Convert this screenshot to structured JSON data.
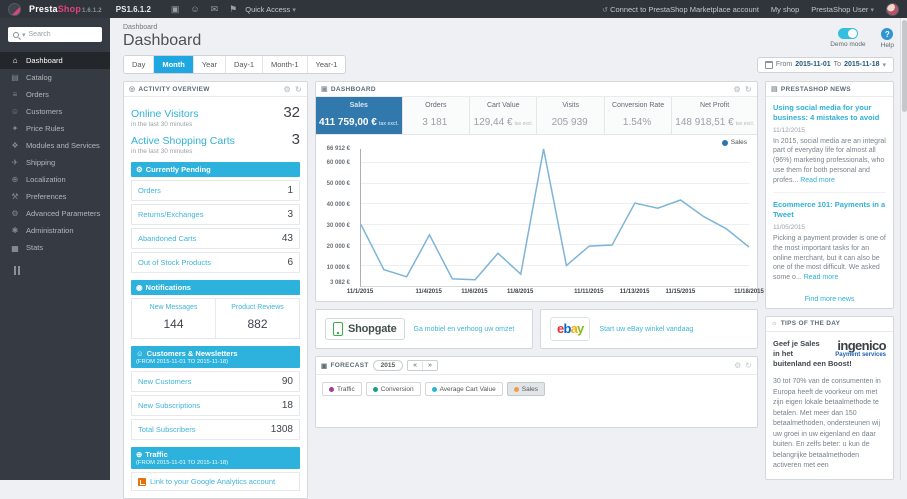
{
  "glyphs": {
    "caret_down": "▾",
    "cart": "▣",
    "person": "☺",
    "envelope": "✉",
    "pin": "⚑",
    "connect": "↺",
    "gear": "⚙",
    "refresh": "↻",
    "target": "◎",
    "bell": "◉",
    "globe": "⊕",
    "news": "▤",
    "bulb": "☼",
    "back": "«",
    "forward": "»",
    "help": "?"
  },
  "topbar": {
    "brand_presta": "Presta",
    "brand_shop": "Shop",
    "brand_version": "1.6.1.2",
    "ps_version": "PS1.6.1.2",
    "quick_access": "Quick Access",
    "connect": "Connect to PrestaShop Marketplace account",
    "my_shop": "My shop",
    "user": "PrestaShop User"
  },
  "sidebar": {
    "search_placeholder": "Search",
    "items": [
      {
        "label": "Dashboard",
        "icon": "⌂",
        "icon_name": "home-icon",
        "active": true
      },
      {
        "label": "Catalog",
        "icon": "▤",
        "icon_name": "catalog-icon"
      },
      {
        "label": "Orders",
        "icon": "≡",
        "icon_name": "orders-icon"
      },
      {
        "label": "Customers",
        "icon": "☺",
        "icon_name": "customers-icon"
      },
      {
        "label": "Price Rules",
        "icon": "✦",
        "icon_name": "price-rules-icon"
      },
      {
        "label": "Modules and Services",
        "icon": "❖",
        "icon_name": "modules-icon"
      },
      {
        "label": "Shipping",
        "icon": "✈",
        "icon_name": "shipping-icon"
      },
      {
        "label": "Localization",
        "icon": "⊕",
        "icon_name": "localization-icon"
      },
      {
        "label": "Preferences",
        "icon": "⚒",
        "icon_name": "preferences-icon"
      },
      {
        "label": "Advanced Parameters",
        "icon": "⚙",
        "icon_name": "advanced-parameters-icon"
      },
      {
        "label": "Administration",
        "icon": "✱",
        "icon_name": "administration-icon"
      },
      {
        "label": "Stats",
        "icon": "▅",
        "icon_name": "stats-icon"
      }
    ]
  },
  "header": {
    "breadcrumb": "Dashboard",
    "title": "Dashboard",
    "demo_mode_label": "Demo mode",
    "help_label": "Help"
  },
  "toolbar": {
    "tabs": [
      {
        "label": "Day"
      },
      {
        "label": "Month",
        "active": true
      },
      {
        "label": "Year"
      },
      {
        "label": "Day-1"
      },
      {
        "label": "Month-1"
      },
      {
        "label": "Year-1"
      }
    ],
    "date": {
      "from_label": "From",
      "from": "2015-11-01",
      "to_label": "To",
      "to": "2015-11-18"
    }
  },
  "activity": {
    "title": "ACTIVITY OVERVIEW",
    "stats": [
      {
        "label": "Online Visitors",
        "value": "32",
        "sub": "in the last 30 minutes"
      },
      {
        "label": "Active Shopping Carts",
        "value": "3",
        "sub": "in the last 30 minutes"
      }
    ],
    "pending": {
      "title": "Currently Pending",
      "rows": [
        {
          "label": "Orders",
          "value": "1"
        },
        {
          "label": "Returns/Exchanges",
          "value": "3"
        },
        {
          "label": "Abandoned Carts",
          "value": "43"
        },
        {
          "label": "Out of Stock Products",
          "value": "6"
        }
      ]
    },
    "notifications": {
      "title": "Notifications",
      "cells": [
        {
          "label": "New Messages",
          "value": "144"
        },
        {
          "label": "Product Reviews",
          "value": "882"
        }
      ]
    },
    "customers": {
      "title": "Customers & Newsletters",
      "subtitle": "(FROM 2015-11-01 TO 2015-11-18)",
      "rows": [
        {
          "label": "New Customers",
          "value": "90"
        },
        {
          "label": "New Subscriptions",
          "value": "18"
        },
        {
          "label": "Total Subscribers",
          "value": "1308"
        }
      ]
    },
    "traffic": {
      "title": "Traffic",
      "subtitle": "(FROM 2015-11-01 TO 2015-11-18)",
      "link": "Link to your Google Analytics account"
    }
  },
  "dashboard_panel": {
    "title": "DASHBOARD",
    "metrics": [
      {
        "label": "Sales",
        "value": "411 759,00 €",
        "note": "tax excl.",
        "active": true
      },
      {
        "label": "Orders",
        "value": "3 181"
      },
      {
        "label": "Cart Value",
        "value": "129,44 €",
        "note": "tax excl."
      },
      {
        "label": "Visits",
        "value": "205 939"
      },
      {
        "label": "Conversion Rate",
        "value": "1.54%"
      },
      {
        "label": "Net Profit",
        "value": "148 918,51 €",
        "note": "tax excl."
      }
    ]
  },
  "chart_data": {
    "type": "line",
    "legend_position": "top-right",
    "grid": "horizontal",
    "legend_dot_color": "#2e75ad",
    "x": [
      "11/1/2015",
      "11/2/2015",
      "11/3/2015",
      "11/4/2015",
      "11/5/2015",
      "11/6/2015",
      "11/7/2015",
      "11/8/2015",
      "11/9/2015",
      "11/10/2015",
      "11/11/2015",
      "11/12/2015",
      "11/13/2015",
      "11/14/2015",
      "11/15/2015",
      "11/16/2015",
      "11/17/2015",
      "11/18/2015"
    ],
    "series": [
      {
        "name": "Sales",
        "color": "#7db4d8",
        "values": [
          30000,
          8000,
          4500,
          25000,
          3500,
          3082,
          16000,
          5800,
          66912,
          10000,
          19500,
          20000,
          40500,
          38000,
          42000,
          34000,
          28000,
          19000
        ]
      }
    ],
    "ylim": [
      0,
      66912
    ],
    "y_ticks": [
      {
        "label": "66 912 €",
        "value": 66912,
        "grid": false
      },
      {
        "label": "60 000 €",
        "value": 60000,
        "grid": true
      },
      {
        "label": "50 000 €",
        "value": 50000,
        "grid": true
      },
      {
        "label": "40 000 €",
        "value": 40000,
        "grid": true
      },
      {
        "label": "30 000 €",
        "value": 30000,
        "grid": true
      },
      {
        "label": "20 000 €",
        "value": 20000,
        "grid": true
      },
      {
        "label": "10 000 €",
        "value": 10000,
        "grid": true
      },
      {
        "label": "3 082 €",
        "value": 3082,
        "grid": false
      }
    ],
    "x_ticks": [
      {
        "label": "11/1/2015",
        "day": 1
      },
      {
        "label": "11/4/2015",
        "day": 4
      },
      {
        "label": "11/6/2015",
        "day": 6
      },
      {
        "label": "11/8/2015",
        "day": 8
      },
      {
        "label": "11/11/2015",
        "day": 11
      },
      {
        "label": "11/13/2015",
        "day": 13
      },
      {
        "label": "11/15/2015",
        "day": 15
      },
      {
        "label": "11/18/2015",
        "day": 18
      }
    ]
  },
  "banner_shopgate": {
    "logo_text": "Shopgate",
    "link": "Ga mobiel en verhoog uw omzet"
  },
  "banner_ebay": {
    "letters": [
      {
        "ch": "e",
        "color": "#e53238"
      },
      {
        "ch": "b",
        "color": "#0064d2"
      },
      {
        "ch": "a",
        "color": "#f5af02"
      },
      {
        "ch": "y",
        "color": "#86b817"
      }
    ],
    "link": "Start uw eBay winkel vandaag"
  },
  "forecast": {
    "title": "FORECAST",
    "year": "2015",
    "legend": [
      {
        "label": "Traffic",
        "color": "#a23d97"
      },
      {
        "label": "Conversion",
        "color": "#16a085"
      },
      {
        "label": "Average Cart Value",
        "color": "#29b7d3"
      },
      {
        "label": "Sales",
        "color": "#f39c42",
        "active": true
      }
    ]
  },
  "news": {
    "title": "PRESTASHOP NEWS",
    "articles": [
      {
        "title": "Using social media for your business: 4 mistakes to avoid",
        "date": "11/12/2015",
        "excerpt": "In 2015, social media are an integral part of everyday life for almost all (96%) marketing professionals, who use them for both personal and profes... ",
        "read_more": "Read more"
      },
      {
        "title": "Ecommerce 101: Payments in a Tweet",
        "date": "11/05/2015",
        "excerpt": "Picking a payment provider is one of the most important tasks for an online merchant, but it can also be one of the most difficult. We asked some o... ",
        "read_more": "Read more"
      }
    ],
    "more_link": "Find more news"
  },
  "tips": {
    "title": "TIPS OF THE DAY",
    "heading": "Geef je Sales in het buitenland een Boost!",
    "logo": "ingenico",
    "logo_sub": "Payment services",
    "body": "30 tot 70% van de consumenten in Europa heeft de voorkeur om met zijn eigen lokale betaalmethode te betalen. Met meer dan 150 betaalmethoden, ondersteunen wij uw groei in uw eigenland en daar buiten. En zelfs beter: u kun de belangrijke betaalmethoden activeren met een"
  }
}
